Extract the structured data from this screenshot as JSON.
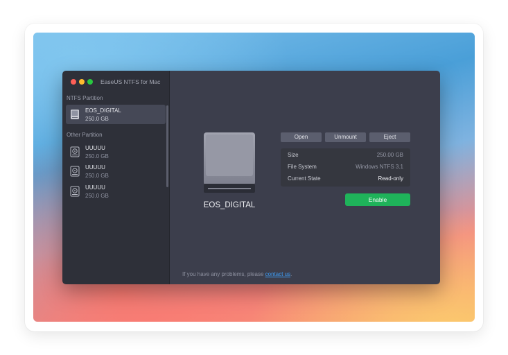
{
  "window": {
    "title": "EaseUS NTFS for Mac"
  },
  "sidebar": {
    "ntfs_section_label": "NTFS Partition",
    "other_section_label": "Other Partition",
    "ntfs_items": [
      {
        "name": "EOS_DIGITAL",
        "size": "250.0 GB",
        "selected": true
      }
    ],
    "other_items": [
      {
        "name": "UUUUU",
        "size": "250.0 GB"
      },
      {
        "name": "UUUUU",
        "size": "250.0 GB"
      },
      {
        "name": "UUUUU",
        "size": "250.0 GB"
      }
    ]
  },
  "main": {
    "drive_name": "EOS_DIGITAL",
    "buttons": {
      "open": "Open",
      "unmount": "Unmount",
      "eject": "Eject"
    },
    "info": [
      {
        "key": "Size",
        "value": "250.00 GB"
      },
      {
        "key": "File System",
        "value": "Windows NTFS 3.1"
      },
      {
        "key": "Current State",
        "value": "Read-only"
      }
    ],
    "enable_label": "Enable",
    "footer_text": "If you have any problems, please ",
    "footer_link": "contact us",
    "footer_end": "."
  },
  "colors": {
    "accent_green": "#1fb35a",
    "link_blue": "#3e9cf3",
    "traffic_red": "#fe5f57",
    "traffic_yellow": "#febc2e",
    "traffic_green": "#28c840"
  },
  "icons": {
    "partition": "hard-drive-icon",
    "drive": "external-disk-icon"
  }
}
